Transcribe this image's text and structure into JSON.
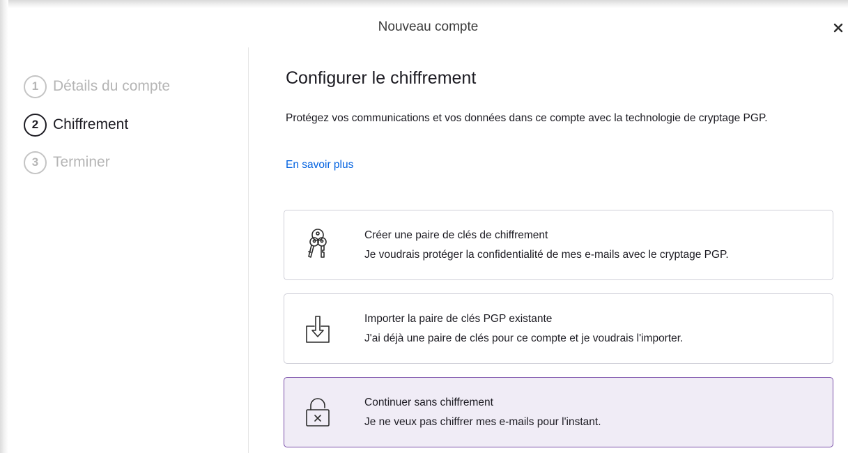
{
  "window": {
    "title": "Nouveau compte",
    "close_icon": "close-icon"
  },
  "steps": [
    {
      "number": "1",
      "label": "Détails du compte",
      "state": "completed"
    },
    {
      "number": "2",
      "label": "Chiffrement",
      "state": "active"
    },
    {
      "number": "3",
      "label": "Terminer",
      "state": "pending"
    }
  ],
  "main": {
    "heading": "Configurer le chiffrement",
    "description": "Protégez vos communications et vos données dans ce compte avec la technologie de cryptage PGP.",
    "learn_more": "En savoir plus",
    "options": [
      {
        "icon": "keys-icon",
        "title": "Créer une paire de clés de chiffrement",
        "subtitle": "Je voudrais protéger la confidentialité de mes e-mails avec le cryptage PGP.",
        "selected": false
      },
      {
        "icon": "import-icon",
        "title": "Importer la paire de clés PGP existante",
        "subtitle": "J'ai déjà une paire de clés pour ce compte et je voudrais l'importer.",
        "selected": false
      },
      {
        "icon": "unlocked-padlock-icon",
        "title": "Continuer sans chiffrement",
        "subtitle": "Je ne veux pas chiffrer mes e-mails pour l'instant.",
        "selected": true
      }
    ]
  },
  "colors": {
    "accent_link": "#0061e0",
    "selected_bg": "#f0ecf6",
    "selected_border": "#7a4fa9",
    "inactive_step": "#b5b5b5",
    "text": "#1c1b22"
  }
}
